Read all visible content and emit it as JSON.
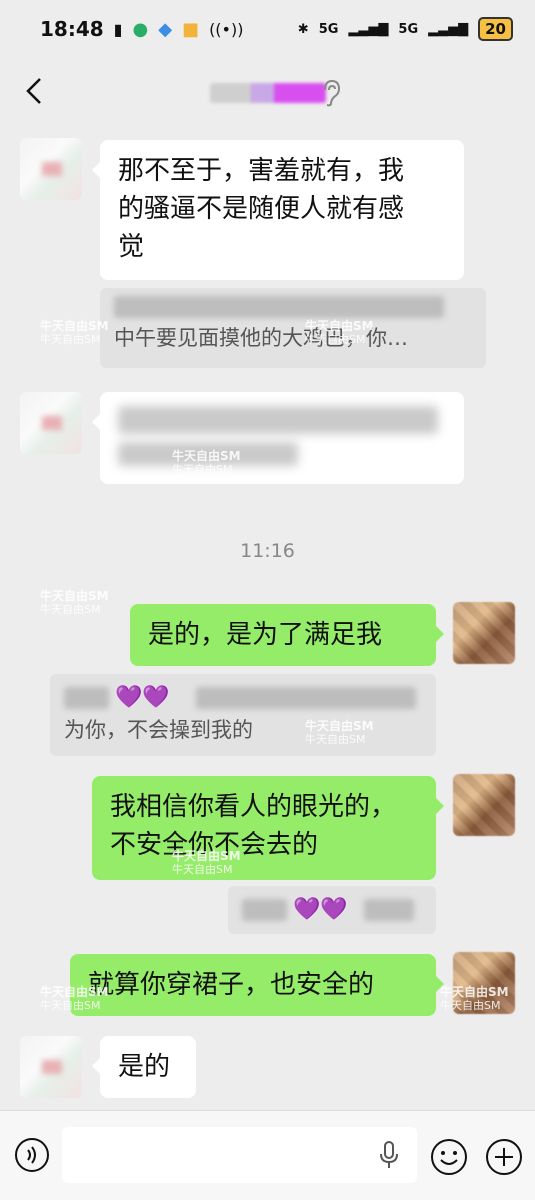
{
  "status_bar": {
    "time": "18:48",
    "net1": "5G",
    "net2": "5G",
    "battery": "20"
  },
  "header": {
    "title": ""
  },
  "messages": {
    "m1": {
      "lines": [
        "那不至于，害羞就有，我",
        "的骚逼不是随便人就有感",
        "觉"
      ]
    },
    "m2_quote": {
      "text": "中午要见面摸他的大鸡巴，你…"
    },
    "timestamp": "11:16",
    "m4": {
      "text": "是的，是为了满足我"
    },
    "m5_quote": {
      "hearts": "💜💜",
      "text": "为你，不会操到我的"
    },
    "m6": {
      "lines": [
        "我相信你看人的眼光的，",
        "不安全你不会去的"
      ]
    },
    "m7_quote": {
      "hearts": "💜💜"
    },
    "m8": {
      "text": "就算你穿裙子，也安全的"
    },
    "m9": {
      "text": "是的"
    }
  },
  "watermark": {
    "title": "牛天自由SM",
    "sub": "牛天自由SM"
  },
  "input": {
    "placeholder": ""
  }
}
